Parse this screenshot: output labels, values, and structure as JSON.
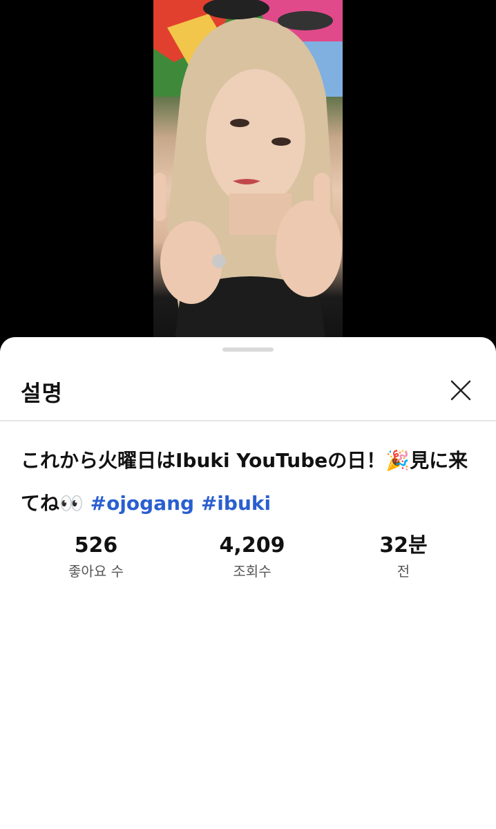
{
  "video": {
    "thumbnail_icon": "video-frame-portrait"
  },
  "sheet": {
    "title": "설명",
    "close_icon": "close-icon"
  },
  "description": {
    "text": "これから火曜日はIbuki YouTubeの日！",
    "party_emoji": "🎉",
    "text2": "見に来てね",
    "eyes_emoji": "👀",
    "hashtag1": "#ojogang",
    "hashtag2": "#ibuki"
  },
  "stats": {
    "likes_value": "526",
    "likes_label": "좋아요 수",
    "views_value": "4,209",
    "views_label": "조회수",
    "time_value": "32분",
    "time_label": "전"
  },
  "colors": {
    "hashtag": "#2a5fd0",
    "background": "#000000",
    "sheet": "#ffffff"
  }
}
